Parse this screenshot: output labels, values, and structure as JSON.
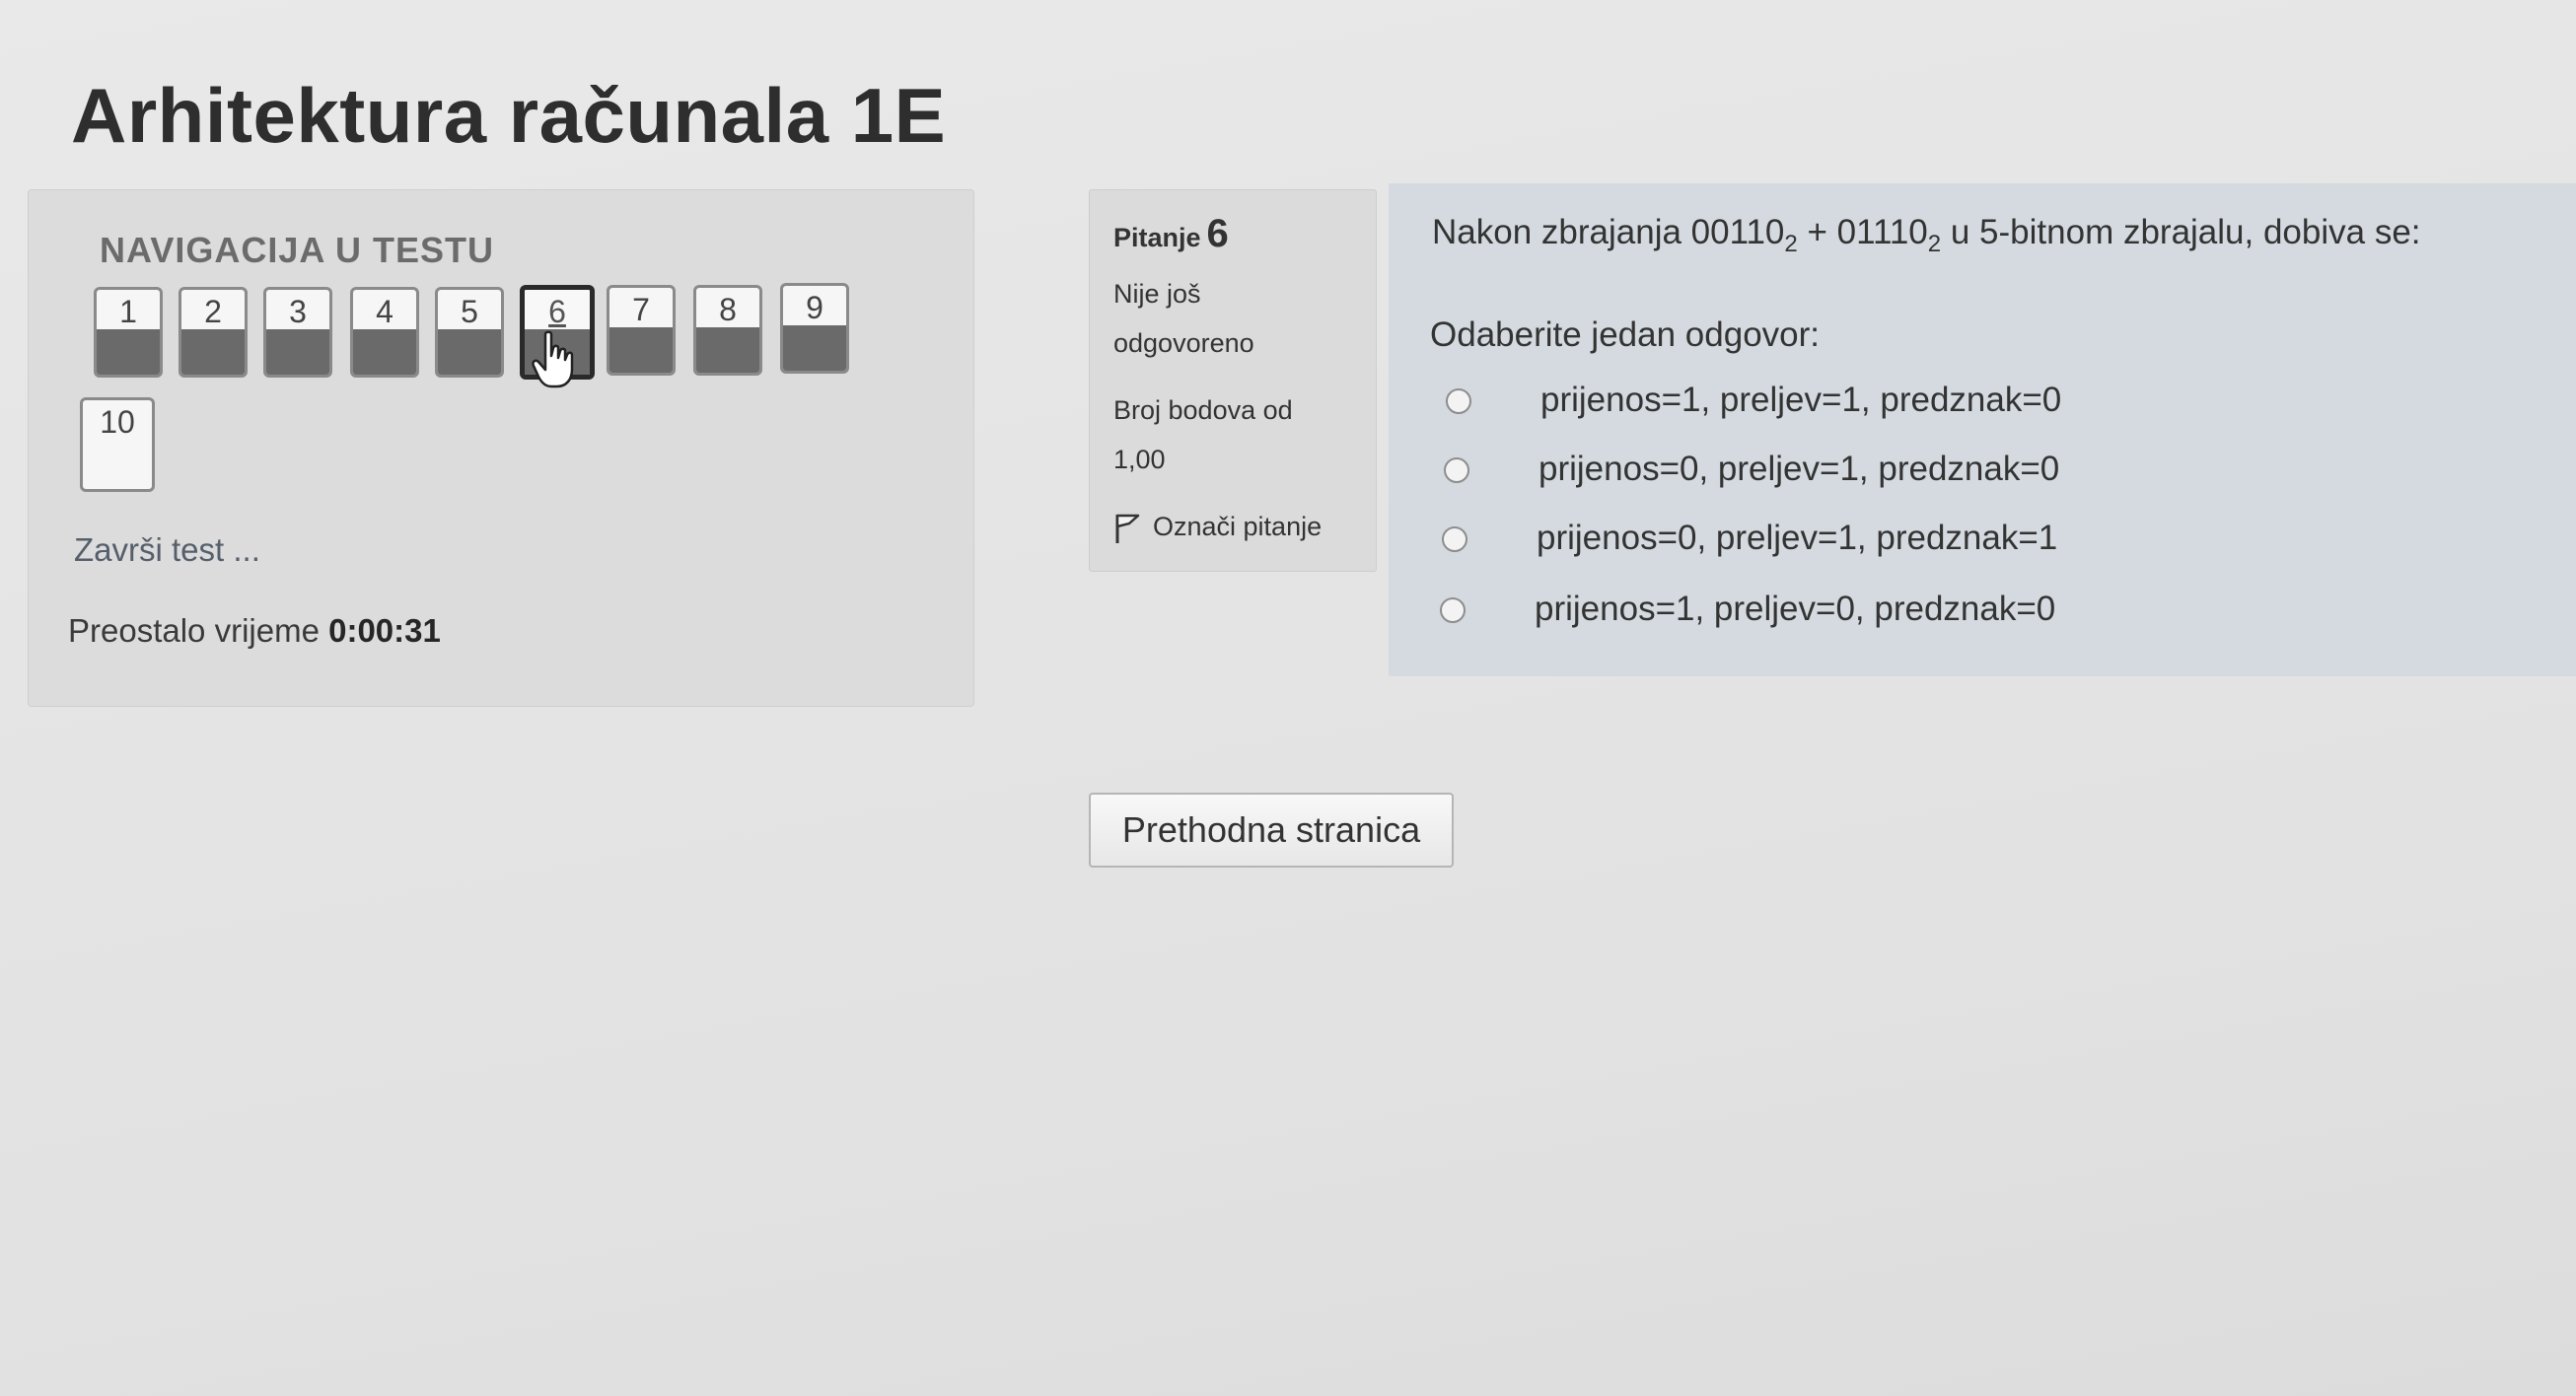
{
  "page": {
    "title": "Arhitektura računala 1E"
  },
  "navigation": {
    "title": "NAVIGACIJA U TESTU",
    "questions": [
      "1",
      "2",
      "3",
      "4",
      "5",
      "6",
      "7",
      "8",
      "9",
      "10"
    ],
    "current_question": "6",
    "finish_label": "Završi test ...",
    "time_label": "Preostalo vrijeme",
    "time_value": "0:00:31"
  },
  "question_info": {
    "label": "Pitanje",
    "number": "6",
    "status_line1": "Nije još",
    "status_line2": "odgovoreno",
    "points_line1": "Broj bodova od",
    "points_line2": "1,00",
    "flag_label": "Označi pitanje",
    "flag_icon": "flag-icon"
  },
  "question": {
    "text_before": "Nakon zbrajanja 00110",
    "sub1": "2",
    "text_mid": " + 01110",
    "sub2": "2",
    "text_after": " u 5-bitnom zbrajalu, dobiva se:",
    "prompt": "Odaberite jedan odgovor:",
    "answers": [
      "prijenos=1, preljev=1, predznak=0",
      "prijenos=0, preljev=1, predznak=0",
      "prijenos=0, preljev=1, predznak=1",
      "prijenos=1, preljev=0, predznak=0"
    ]
  },
  "buttons": {
    "previous_page": "Prethodna stranica"
  },
  "cursor_icon": "hand-pointer-icon"
}
